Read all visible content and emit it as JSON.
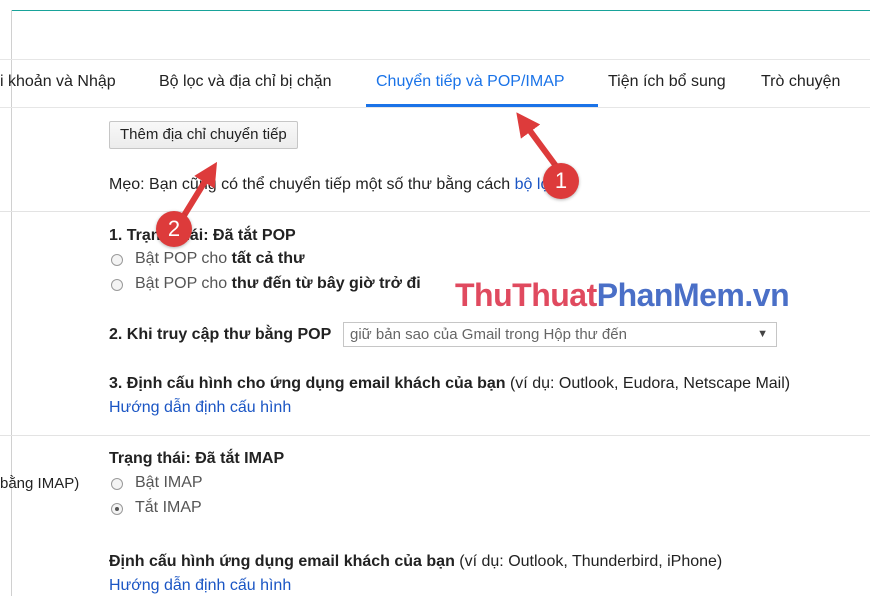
{
  "tabs": [
    {
      "label": "i khoản và Nhập"
    },
    {
      "label": "Bộ lọc và địa chỉ bị chặn"
    },
    {
      "label": "Chuyển tiếp và POP/IMAP"
    },
    {
      "label": "Tiện ích bổ sung"
    },
    {
      "label": "Trò chuyện"
    }
  ],
  "forwarding": {
    "add_button": "Thêm địa chỉ chuyển tiếp",
    "tip_prefix": "Mẹo: Bạn cũng có thể chuyển tiếp một số thư bằng cách",
    "tip_link": "bộ lọc!"
  },
  "pop": {
    "status_label": "1. Trạng thái: Đã tắt POP",
    "option_all_prefix": "Bật POP cho ",
    "option_all_bold": "tất cả thư",
    "option_new_prefix": "Bật POP cho ",
    "option_new_bold": "thư đến từ bây giờ trở đi",
    "access_label": "2. Khi truy cập thư bằng POP",
    "access_select_value": "giữ bản sao của Gmail trong Hộp thư đến",
    "configure_label": "3. Định cấu hình cho ứng dụng email khách của bạn",
    "configure_example": " (ví dụ: Outlook, Eudora, Netscape Mail)",
    "configure_link": "Hướng dẫn định cấu hình"
  },
  "imap": {
    "side_label": "bằng IMAP)",
    "status_label": "Trạng thái: Đã tắt IMAP",
    "option_on": "Bật IMAP",
    "option_off": "Tắt IMAP",
    "selected": "Tắt IMAP",
    "configure_label": "Định cấu hình ứng dụng email khách của bạn",
    "configure_example": " (ví dụ: Outlook, Thunderbird, iPhone)",
    "configure_link": "Hướng dẫn định cấu hình"
  },
  "annotations": {
    "badge_1": "1",
    "badge_2": "2",
    "color": "#dd3b3b"
  },
  "watermark": {
    "part1": "ThuThuat",
    "part2": "PhanMem.vn"
  },
  "colors": {
    "accent": "#1a73e8",
    "link": "#1a55c4"
  }
}
